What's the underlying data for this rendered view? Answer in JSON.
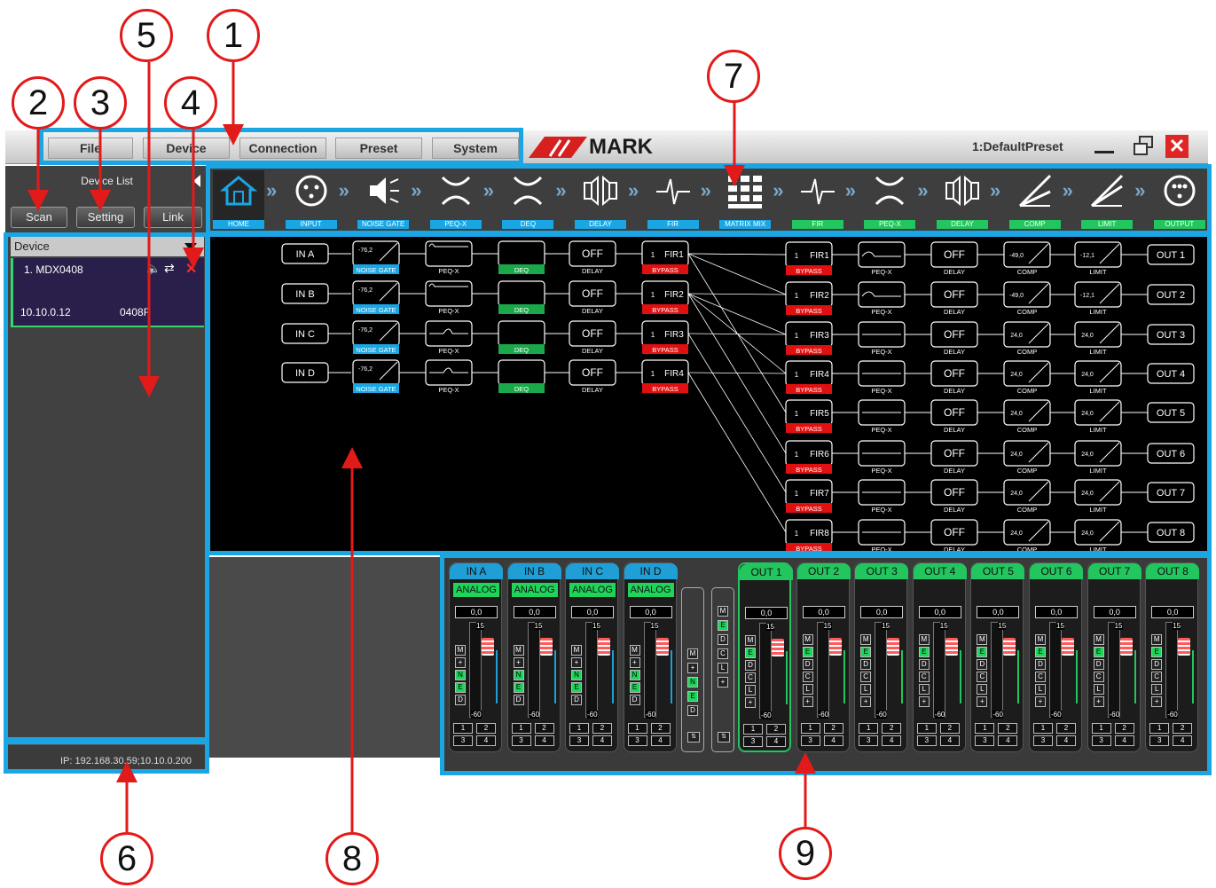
{
  "menu": {
    "items": [
      "File",
      "Device",
      "Connection",
      "Preset",
      "System"
    ]
  },
  "brand": {
    "logo_text": "MARK"
  },
  "title": {
    "preset": "1:DefaultPreset"
  },
  "device_list": {
    "title": "Device List",
    "buttons": {
      "scan": "Scan",
      "setting": "Setting",
      "link": "Link"
    },
    "header": "Device",
    "device": {
      "name": "1. MDX0408",
      "ip": "10.10.0.12",
      "code": "0408F"
    }
  },
  "status": {
    "ip_text": "IP: 192.168.30.59;10.10.0.200"
  },
  "toolbar": {
    "items": [
      "HOME",
      "INPUT",
      "NOISE GATE",
      "PEQ-X",
      "DEQ",
      "DELAY",
      "FIR",
      "MATRIX MIX",
      "FIR",
      "PEQ-X",
      "DELAY",
      "COMP",
      "LIMIT",
      "OUTPUT"
    ]
  },
  "diagram": {
    "inputs": [
      "IN A",
      "IN B",
      "IN C",
      "IN D"
    ],
    "input_gate_value": "-76,2",
    "block_labels": {
      "noise_gate": "NOISE GATE",
      "peq": "PEQ-X",
      "deq": "DEQ",
      "delay": "DELAY",
      "bypass": "BYPASS",
      "comp": "COMP",
      "limit": "LIMIT"
    },
    "delay_value": "OFF",
    "fir_input": [
      "FIR1",
      "FIR2",
      "FIR3",
      "FIR4"
    ],
    "fir_output": [
      "FIR1",
      "FIR2",
      "FIR3",
      "FIR4",
      "FIR5",
      "FIR6",
      "FIR7",
      "FIR8"
    ],
    "fir_index": "1",
    "comp_values": [
      "-49,0",
      "-49,0",
      "24,0",
      "24,0",
      "24,0",
      "24,0",
      "24,0",
      "24,0"
    ],
    "limit_values": [
      "-12,1",
      "-12,1",
      "24,0",
      "24,0",
      "24,0",
      "24,0",
      "24,0",
      "24,0"
    ],
    "outputs": [
      "OUT 1",
      "OUT 2",
      "OUT 3",
      "OUT 4",
      "OUT 5",
      "OUT 6",
      "OUT 7",
      "OUT 8"
    ]
  },
  "mixer": {
    "inputs": [
      "IN A",
      "IN B",
      "IN C",
      "IN D"
    ],
    "outputs": [
      "OUT 1",
      "OUT 2",
      "OUT 3",
      "OUT 4",
      "OUT 5",
      "OUT 6",
      "OUT 7",
      "OUT 8"
    ],
    "source_label": "ANALOG",
    "gain_value": "0,0",
    "scale_top": "15",
    "scale_bottom": "-60",
    "input_buttons": [
      "M",
      "+",
      "N",
      "E",
      "D"
    ],
    "output_buttons": [
      "M",
      "E",
      "D",
      "C",
      "L",
      "+"
    ],
    "num_buttons": [
      "1",
      "2",
      "3",
      "4"
    ]
  },
  "callouts": [
    "1",
    "2",
    "3",
    "4",
    "5",
    "6",
    "7",
    "8",
    "9"
  ],
  "colors": {
    "accent_blue": "#1aa6e3",
    "callout_red": "#e21a1a",
    "input_strip": "#1f9fd6",
    "output_strip": "#22c55e",
    "bypass_red": "#e01010"
  }
}
